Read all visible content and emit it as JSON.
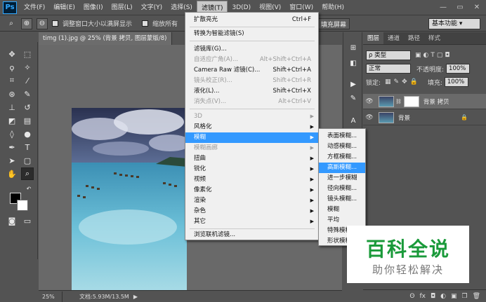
{
  "app": {
    "logo": "Ps"
  },
  "menubar": {
    "items": [
      "文件(F)",
      "编辑(E)",
      "图像(I)",
      "图层(L)",
      "文字(Y)",
      "选择(S)",
      "滤镜(T)",
      "3D(D)",
      "视图(V)",
      "窗口(W)",
      "帮助(H)"
    ],
    "active_index": 6
  },
  "window_controls": {
    "minimize": "—",
    "maximize": "▭",
    "close": "✕"
  },
  "options_bar": {
    "resize_window_label": "调整窗口大小以满屏显示",
    "zoom_all_label": "缩放所有",
    "fill_screen_label": "填充屏幕",
    "workspace_value": "基本功能 ▾"
  },
  "document": {
    "tab_title": "timg (1).jpg @ 25% (背景 拷贝, 图层蒙版/8) *",
    "tab_close": "×"
  },
  "status_bar": {
    "zoom": "25%",
    "doc_info": "文档:5.93M/13.5M",
    "arrow": "▶"
  },
  "filter_menu": {
    "items": [
      {
        "label": "扩散亮光",
        "shortcut": "Ctrl+F",
        "disabled": false
      },
      {
        "label": "转换为智能滤镜(S)",
        "shortcut": "",
        "disabled": false
      },
      {
        "label": "滤镜库(G)...",
        "shortcut": "",
        "disabled": false
      },
      {
        "label": "自适应广角(A)...",
        "shortcut": "Alt+Shift+Ctrl+A",
        "disabled": true
      },
      {
        "label": "Camera Raw 滤镜(C)...",
        "shortcut": "Shift+Ctrl+A",
        "disabled": false
      },
      {
        "label": "镜头校正(R)...",
        "shortcut": "Shift+Ctrl+R",
        "disabled": true
      },
      {
        "label": "液化(L)...",
        "shortcut": "Shift+Ctrl+X",
        "disabled": false
      },
      {
        "label": "消失点(V)...",
        "shortcut": "Alt+Ctrl+V",
        "disabled": true
      },
      {
        "label": "3D",
        "shortcut": "",
        "disabled": true,
        "submenu": true
      },
      {
        "label": "风格化",
        "shortcut": "",
        "disabled": false,
        "submenu": true
      },
      {
        "label": "模糊",
        "shortcut": "",
        "disabled": false,
        "submenu": true,
        "highlighted": true
      },
      {
        "label": "模糊画廊",
        "shortcut": "",
        "disabled": true,
        "submenu": true
      },
      {
        "label": "扭曲",
        "shortcut": "",
        "disabled": false,
        "submenu": true
      },
      {
        "label": "锐化",
        "shortcut": "",
        "disabled": false,
        "submenu": true
      },
      {
        "label": "视频",
        "shortcut": "",
        "disabled": false,
        "submenu": true
      },
      {
        "label": "像素化",
        "shortcut": "",
        "disabled": false,
        "submenu": true
      },
      {
        "label": "渲染",
        "shortcut": "",
        "disabled": false,
        "submenu": true
      },
      {
        "label": "杂色",
        "shortcut": "",
        "disabled": false,
        "submenu": true
      },
      {
        "label": "其它",
        "shortcut": "",
        "disabled": false,
        "submenu": true
      },
      {
        "label": "浏览联机滤镜...",
        "shortcut": "",
        "disabled": false
      }
    ],
    "submenu_arrow": "▶"
  },
  "blur_submenu": {
    "items": [
      "表面模糊...",
      "动感模糊...",
      "方框模糊...",
      "高斯模糊...",
      "进一步模糊",
      "径向模糊...",
      "镜头模糊...",
      "模糊",
      "平均",
      "特殊模糊...",
      "形状模糊..."
    ],
    "highlighted_index": 3
  },
  "layers_panel": {
    "tabs": [
      "图层",
      "通道",
      "路径",
      "样式"
    ],
    "active_tab": 0,
    "kind_filter": "ρ 类型",
    "blend_mode": "正常",
    "opacity_label": "不透明度:",
    "opacity_value": "100%",
    "lock_label": "锁定:",
    "fill_label": "填充:",
    "fill_value": "100%",
    "layers": [
      {
        "name": "背景 拷贝",
        "has_mask": true,
        "selected": true
      },
      {
        "name": "背景",
        "has_mask": false,
        "locked": true
      }
    ],
    "bottom_icons": [
      "ʘ",
      "fx",
      "◘",
      "◐",
      "▣",
      "❐",
      "🗑"
    ]
  },
  "watermark": {
    "title": "百科全说",
    "subtitle": "助你轻松解决"
  }
}
